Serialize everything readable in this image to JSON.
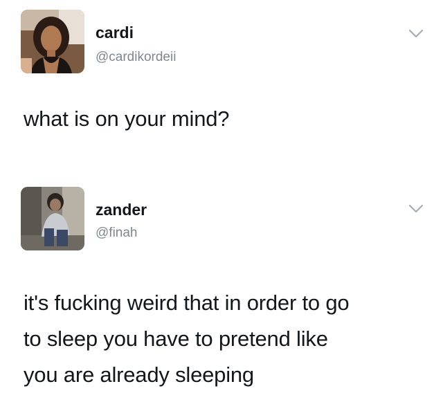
{
  "tweets": [
    {
      "display_name": "cardi",
      "handle": "@cardikordeii",
      "text": "what is on your mind?",
      "avatar_icon": "profile-photo-woman",
      "menu_icon": "chevron-down-icon"
    },
    {
      "display_name": "zander",
      "handle": "@finah",
      "text": "it's fucking weird that in order to go\nto sleep you have to pretend like\nyou are already sleeping",
      "avatar_icon": "profile-photo-man",
      "menu_icon": "chevron-down-icon"
    }
  ],
  "colors": {
    "name": "#14171a",
    "handle": "#7d8790",
    "caret": "#a3adb5",
    "background": "#ffffff"
  }
}
